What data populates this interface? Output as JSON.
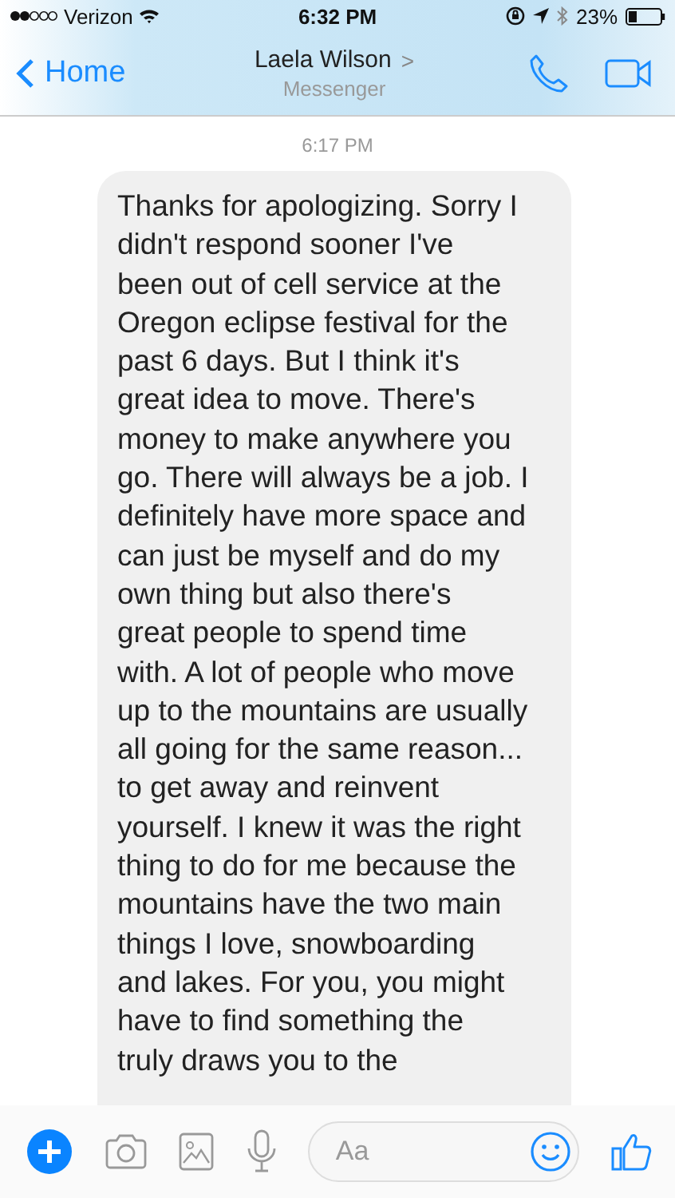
{
  "status_bar": {
    "carrier": "Verizon",
    "time": "6:32 PM",
    "battery": "23%"
  },
  "header": {
    "back": "Home",
    "title": "Laela Wilson",
    "chevron": ">",
    "subtitle": "Messenger"
  },
  "timestamp": "6:17 PM",
  "message": {
    "lines": [
      "Thanks for apologizing. Sorry I",
      "didn't respond sooner I've",
      "been out of cell service at the",
      "Oregon eclipse festival for the",
      "past 6 days. But I think it's",
      "great idea to move. There's",
      "money to make anywhere you",
      "go. There will always be a job. I",
      "definitely have more space and",
      "can just be myself and do my",
      "own thing but also there's",
      "great people to spend time",
      "with. A lot of people who move",
      "up to the mountains are usually",
      "all going for the same reason...",
      "to get away and reinvent",
      "yourself. I knew it was the right",
      "thing to do for me because the",
      "mountains have the two main",
      "things I love, snowboarding",
      "and lakes. For you, you might",
      "have to find something the",
      "truly draws you to the"
    ]
  },
  "composer": {
    "placeholder": "Aa"
  }
}
